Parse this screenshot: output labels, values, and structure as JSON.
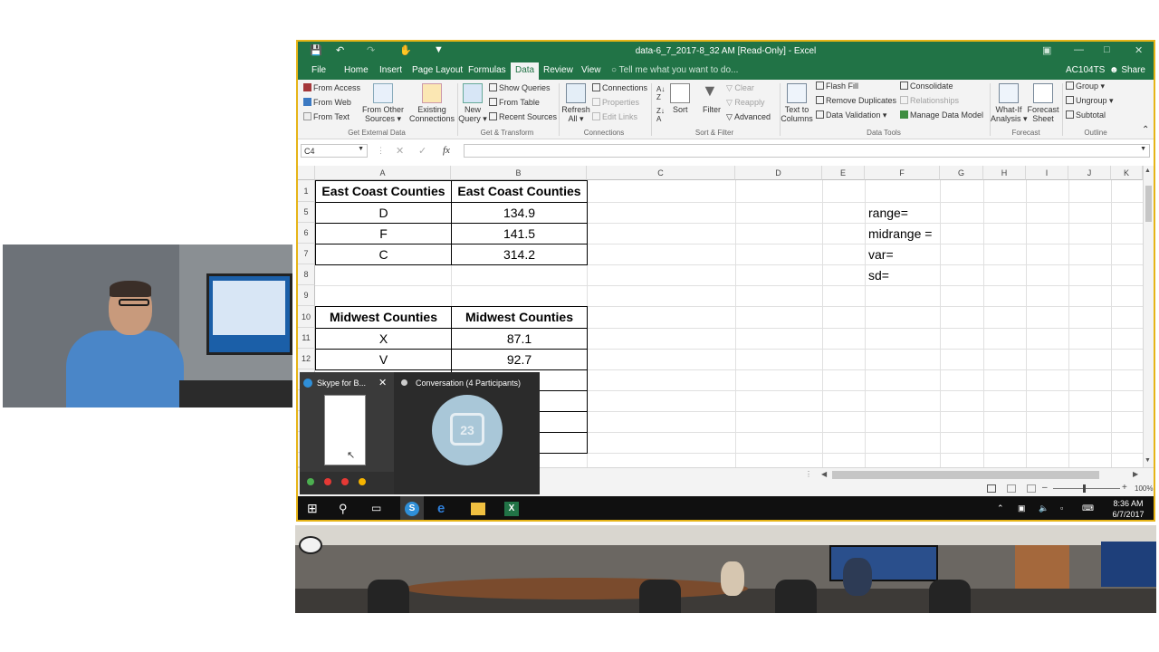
{
  "window": {
    "title": "data-6_7_2017-8_32 AM  [Read-Only]  -  Excel",
    "user": "AC104TS",
    "share": "Share"
  },
  "menu": {
    "file": "File",
    "home": "Home",
    "insert": "Insert",
    "page_layout": "Page Layout",
    "formulas": "Formulas",
    "data": "Data",
    "review": "Review",
    "view": "View",
    "tell_me": "Tell me what you want to do..."
  },
  "ribbon": {
    "get_external": {
      "from_access": "From Access",
      "from_web": "From Web",
      "from_text": "From Text",
      "from_other_1": "From Other",
      "from_other_2": "Sources",
      "existing_1": "Existing",
      "existing_2": "Connections",
      "label": "Get External Data"
    },
    "get_transform": {
      "new_query_1": "New",
      "new_query_2": "Query",
      "show_queries": "Show Queries",
      "from_table": "From Table",
      "recent_sources": "Recent Sources",
      "label": "Get & Transform"
    },
    "connections": {
      "refresh_1": "Refresh",
      "refresh_2": "All",
      "connections": "Connections",
      "properties": "Properties",
      "edit_links": "Edit Links",
      "label": "Connections"
    },
    "sort_filter": {
      "sort": "Sort",
      "filter": "Filter",
      "clear": "Clear",
      "reapply": "Reapply",
      "advanced": "Advanced",
      "label": "Sort & Filter"
    },
    "data_tools": {
      "text_to_1": "Text to",
      "text_to_2": "Columns",
      "flash_fill": "Flash Fill",
      "remove_duplicates": "Remove Duplicates",
      "data_validation": "Data Validation",
      "consolidate": "Consolidate",
      "relationships": "Relationships",
      "manage_model": "Manage Data Model",
      "label": "Data Tools"
    },
    "forecast": {
      "what_if_1": "What-If",
      "what_if_2": "Analysis",
      "forecast_1": "Forecast",
      "forecast_2": "Sheet",
      "label": "Forecast"
    },
    "outline": {
      "group": "Group",
      "ungroup": "Ungroup",
      "subtotal": "Subtotal",
      "label": "Outline"
    }
  },
  "formula_bar": {
    "name_box": "C4",
    "fx": "fx",
    "value": ""
  },
  "columns": [
    "A",
    "B",
    "C",
    "D",
    "E",
    "F",
    "G",
    "H",
    "I",
    "J",
    "K"
  ],
  "rows": [
    "1",
    "5",
    "6",
    "7",
    "8",
    "9",
    "10",
    "11",
    "12"
  ],
  "cells": {
    "a1": "East Coast Counties",
    "b1": "East Coast Counties",
    "a5": "D",
    "b5": "134.9",
    "a6": "F",
    "b6": "141.5",
    "a7": "C",
    "b7": "314.2",
    "a10": "Midwest Counties",
    "b10": "Midwest Counties",
    "a11": "X",
    "b11": "87.1",
    "a12": "V",
    "b12": "92.7",
    "f5": "range=",
    "f6": "midrange =",
    "f7": "var=",
    "f8": "sd="
  },
  "status": {
    "zoom": "100%"
  },
  "taskbar": {
    "time": "8:36 AM",
    "date": "6/7/2017"
  },
  "popup": {
    "skype_title": "Skype for B...",
    "conversation_title": "Conversation (4 Participants)",
    "calendar_day": "23"
  },
  "colors": {
    "excel_green": "#217346",
    "highlight_border": "#e6b417"
  }
}
